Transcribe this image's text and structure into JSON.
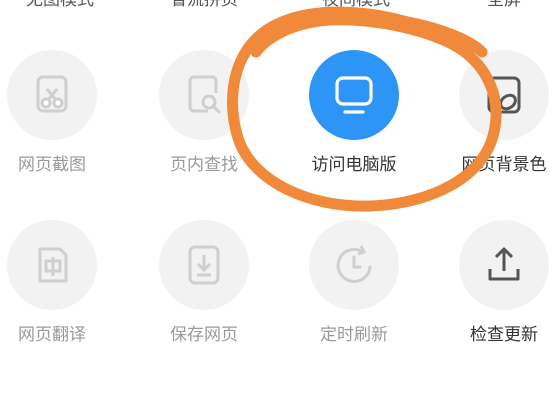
{
  "top_row_partial": [
    "无图模式",
    "省流拼页",
    "夜间模式",
    "全屏"
  ],
  "grid": [
    {
      "label": "网页截图",
      "icon": "screenshot-scissors-icon"
    },
    {
      "label": "页内查找",
      "icon": "find-in-page-icon"
    },
    {
      "label": "访问电脑版",
      "icon": "desktop-monitor-icon"
    },
    {
      "label": "网页背景色",
      "icon": "background-color-icon"
    },
    {
      "label": "网页翻译",
      "icon": "translate-icon"
    },
    {
      "label": "保存网页",
      "icon": "save-page-icon"
    },
    {
      "label": "定时刷新",
      "icon": "timer-refresh-icon"
    },
    {
      "label": "检查更新",
      "icon": "upload-update-icon"
    }
  ],
  "colors": {
    "accent": "#2d95f5",
    "circle_bg": "#f2f2f2",
    "disabled_icon": "#cfcfcf",
    "label_gray": "#9a9a9a",
    "label_dark": "#333333",
    "annotation": "#f0893a"
  }
}
